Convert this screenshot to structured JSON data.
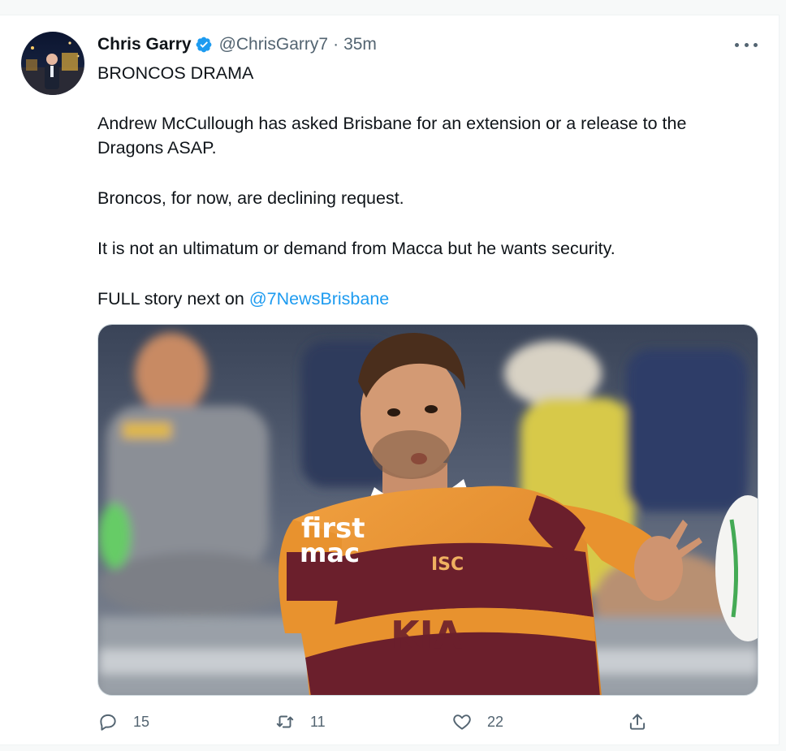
{
  "tweet": {
    "display_name": "Chris Garry",
    "handle": "@ChrisGarry7",
    "separator": "·",
    "timestamp": "35m",
    "verified": true,
    "lines": {
      "l1": "BRONCOS DRAMA",
      "l2": "Andrew McCullough has asked Brisbane for an extension or a release to the Dragons ASAP.",
      "l3": "Broncos, for now, are declining request.",
      "l4": "It is not an ultimatum or demand from Macca but he wants security.",
      "l5_prefix": "FULL story next on ",
      "l5_mention": "@7NewsBrisbane"
    },
    "media": {
      "jersey_text_1": "first",
      "jersey_text_2": "mac",
      "jersey_text_3": "ISC",
      "jersey_text_4": "KIA"
    },
    "actions": {
      "replies": "15",
      "retweets": "11",
      "likes": "22"
    }
  },
  "colors": {
    "accent": "#1d9bf0",
    "secondary_text": "#536471",
    "primary_text": "#0f1419",
    "jersey_orange": "#e8922e",
    "jersey_maroon": "#6b1f2c"
  },
  "icons": {
    "reply": "reply-icon",
    "retweet": "retweet-icon",
    "like": "heart-icon",
    "share": "share-icon",
    "more": "more-icon",
    "verified": "verified-badge-icon"
  }
}
